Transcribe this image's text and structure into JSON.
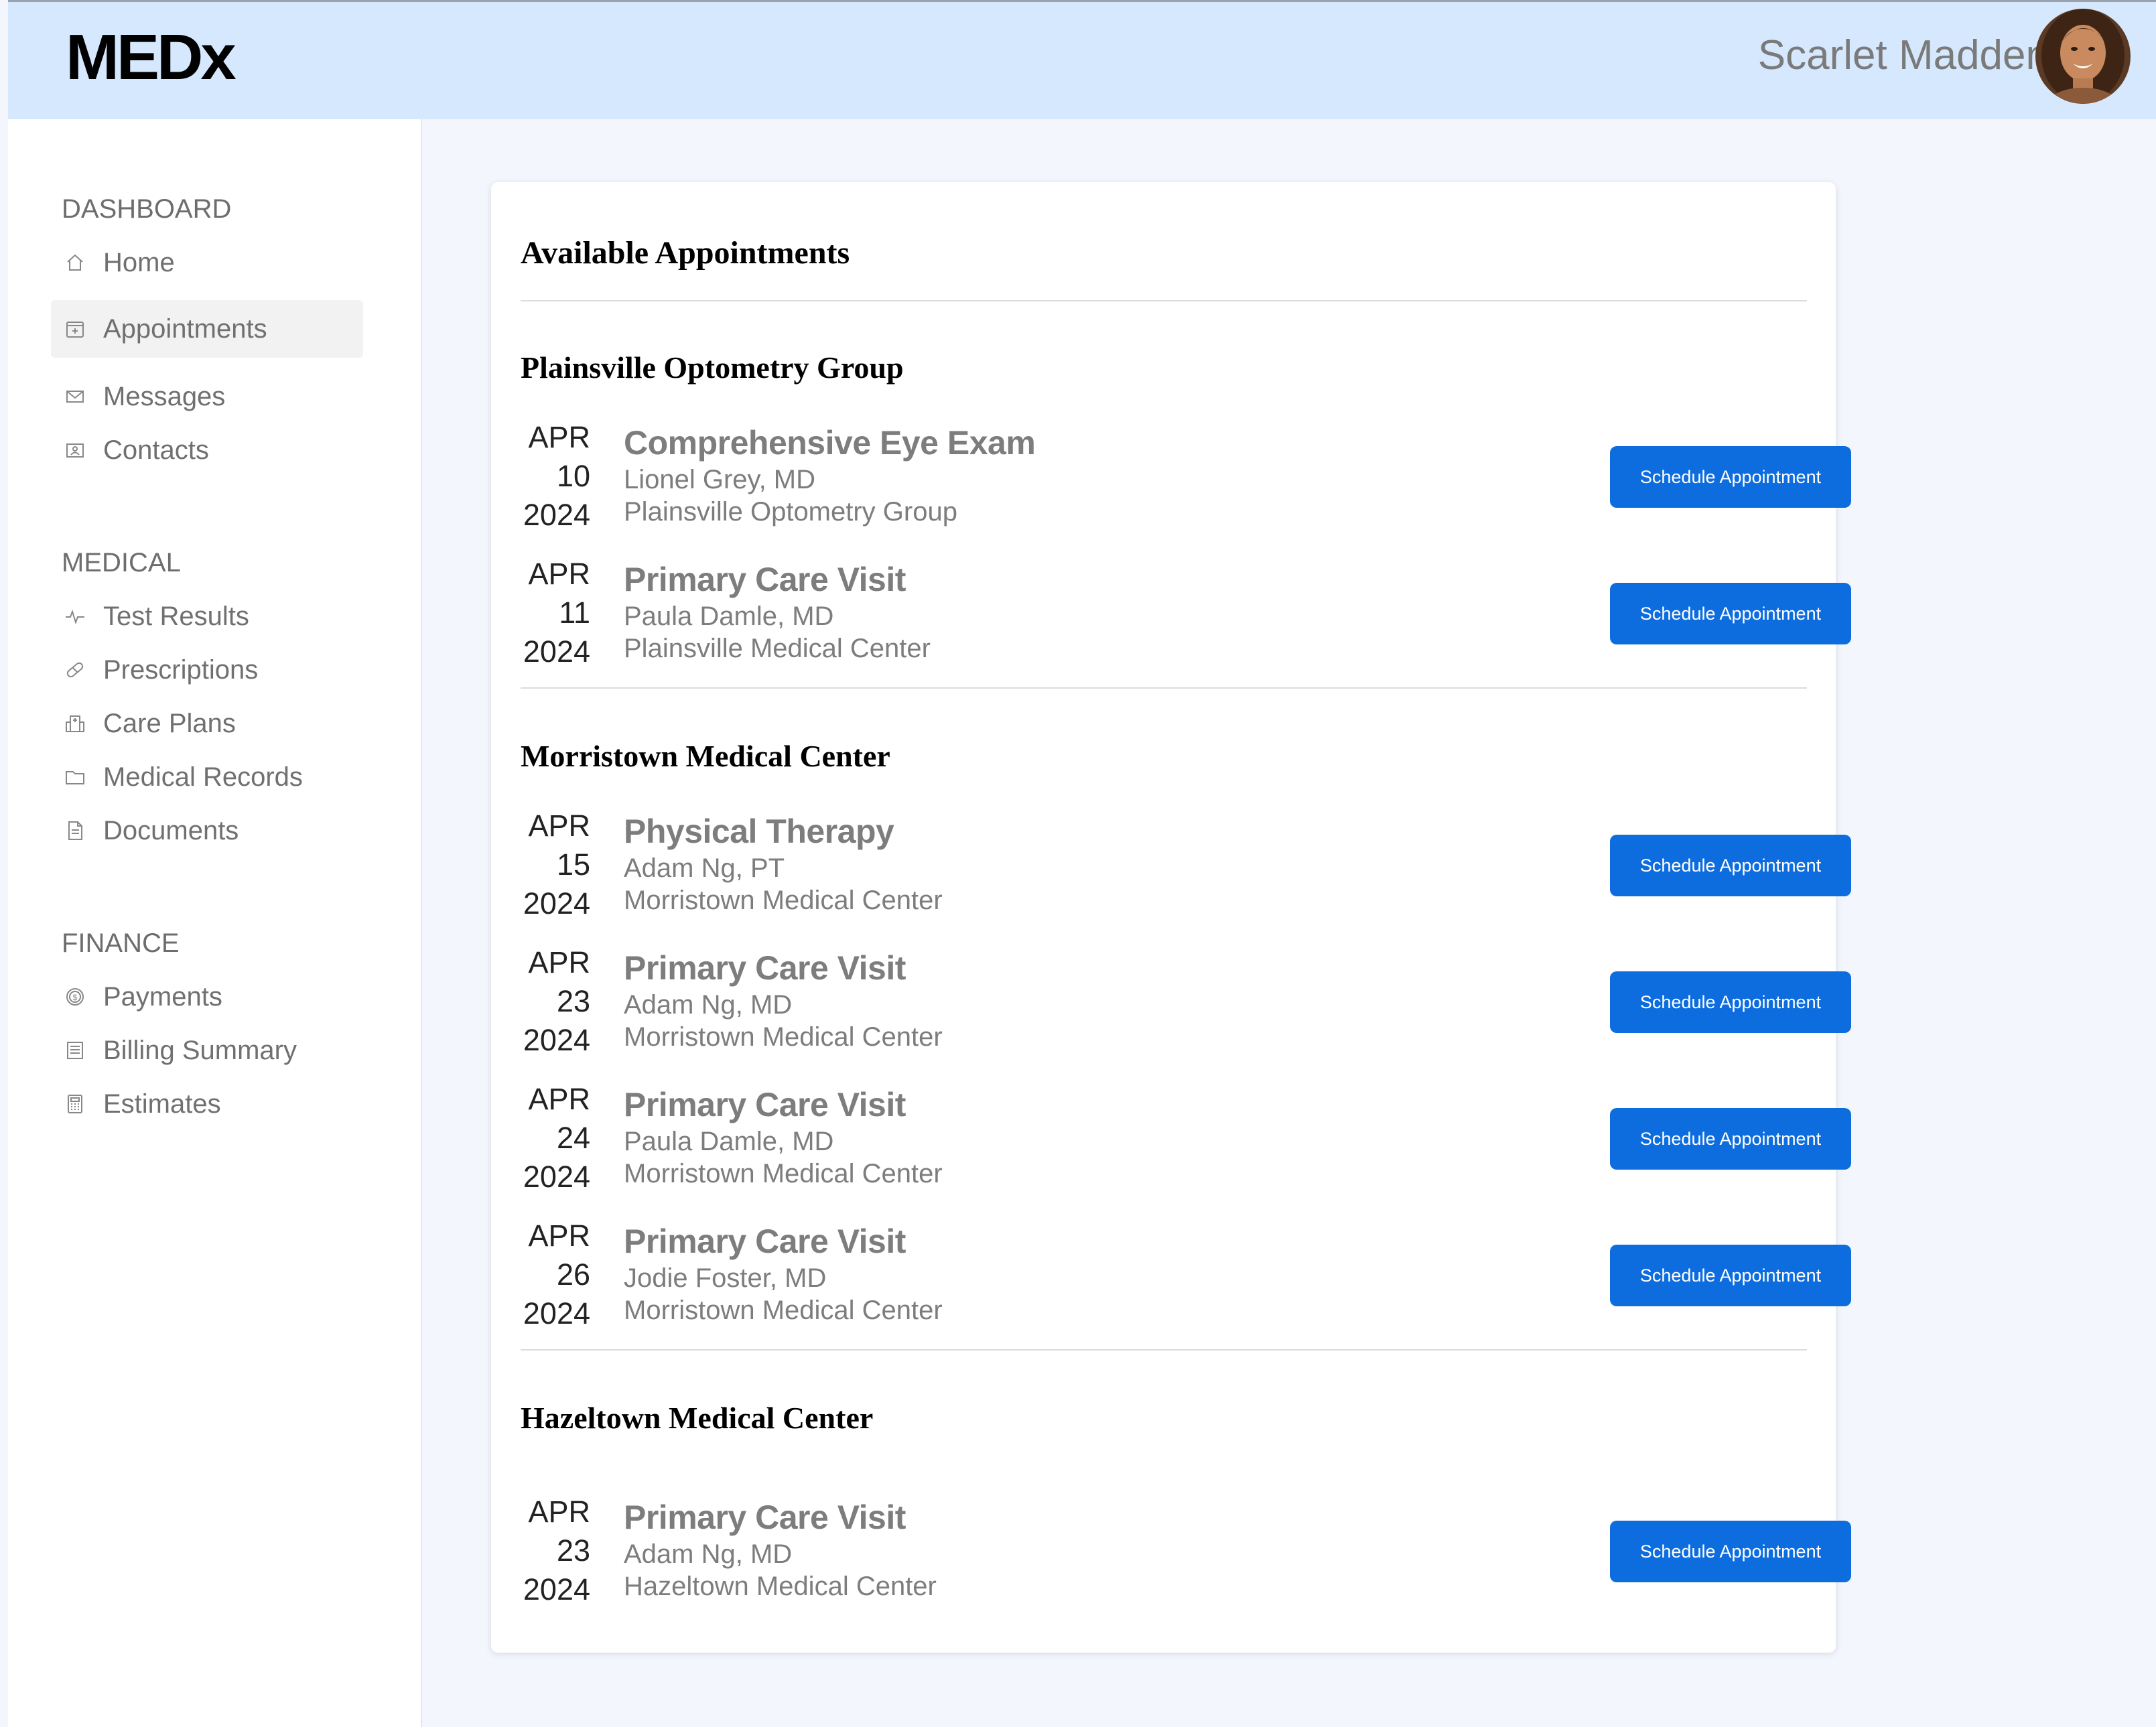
{
  "app": {
    "logo": "MEDx",
    "user_name": "Scarlet Madden"
  },
  "sidebar": {
    "sections": [
      {
        "title": "DASHBOARD",
        "items": [
          {
            "label": "Home",
            "icon": "home-icon"
          },
          {
            "label": "Appointments",
            "icon": "calendar-plus-icon",
            "active": true
          },
          {
            "label": "Messages",
            "icon": "mail-icon"
          },
          {
            "label": "Contacts",
            "icon": "contact-card-icon"
          }
        ]
      },
      {
        "title": "MEDICAL",
        "items": [
          {
            "label": "Test Results",
            "icon": "pulse-icon"
          },
          {
            "label": "Prescriptions",
            "icon": "pill-icon"
          },
          {
            "label": "Care Plans",
            "icon": "hospital-icon"
          },
          {
            "label": "Medical Records",
            "icon": "folder-icon"
          },
          {
            "label": "Documents",
            "icon": "document-icon"
          }
        ]
      },
      {
        "title": "FINANCE",
        "items": [
          {
            "label": "Payments",
            "icon": "dollar-coin-icon"
          },
          {
            "label": "Billing Summary",
            "icon": "receipt-icon"
          },
          {
            "label": "Estimates",
            "icon": "calculator-icon"
          }
        ]
      }
    ]
  },
  "main": {
    "title": "Available Appointments",
    "button_label": "Schedule Appointment",
    "groups": [
      {
        "name": "Plainsville Optometry Group",
        "appointments": [
          {
            "month": "APR",
            "day": "10",
            "year": "2024",
            "type": "Comprehensive Eye Exam",
            "provider": "Lionel Grey, MD",
            "location": "Plainsville Optometry Group"
          },
          {
            "month": "APR",
            "day": "11",
            "year": "2024",
            "type": "Primary Care Visit",
            "provider": "Paula Damle, MD",
            "location": "Plainsville Medical Center"
          }
        ]
      },
      {
        "name": "Morristown Medical Center",
        "appointments": [
          {
            "month": "APR",
            "day": "15",
            "year": "2024",
            "type": "Physical Therapy",
            "provider": "Adam Ng, PT",
            "location": "Morristown Medical Center"
          },
          {
            "month": "APR",
            "day": "23",
            "year": "2024",
            "type": "Primary Care Visit",
            "provider": "Adam Ng, MD",
            "location": "Morristown Medical Center"
          },
          {
            "month": "APR",
            "day": "24",
            "year": "2024",
            "type": "Primary Care Visit",
            "provider": "Paula Damle, MD",
            "location": "Morristown Medical Center"
          },
          {
            "month": "APR",
            "day": "26",
            "year": "2024",
            "type": "Primary Care Visit",
            "provider": "Jodie Foster, MD",
            "location": "Morristown Medical Center"
          }
        ]
      },
      {
        "name": "Hazeltown Medical Center",
        "appointments": [
          {
            "month": "APR",
            "day": "23",
            "year": "2024",
            "type": "Primary Care Visit",
            "provider": "Adam Ng, MD",
            "location": "Hazeltown Medical Center"
          }
        ]
      }
    ]
  },
  "colors": {
    "header_bg": "#d6e8fd",
    "button_bg": "#0d6ddf",
    "page_bg": "#f3f7fd"
  }
}
